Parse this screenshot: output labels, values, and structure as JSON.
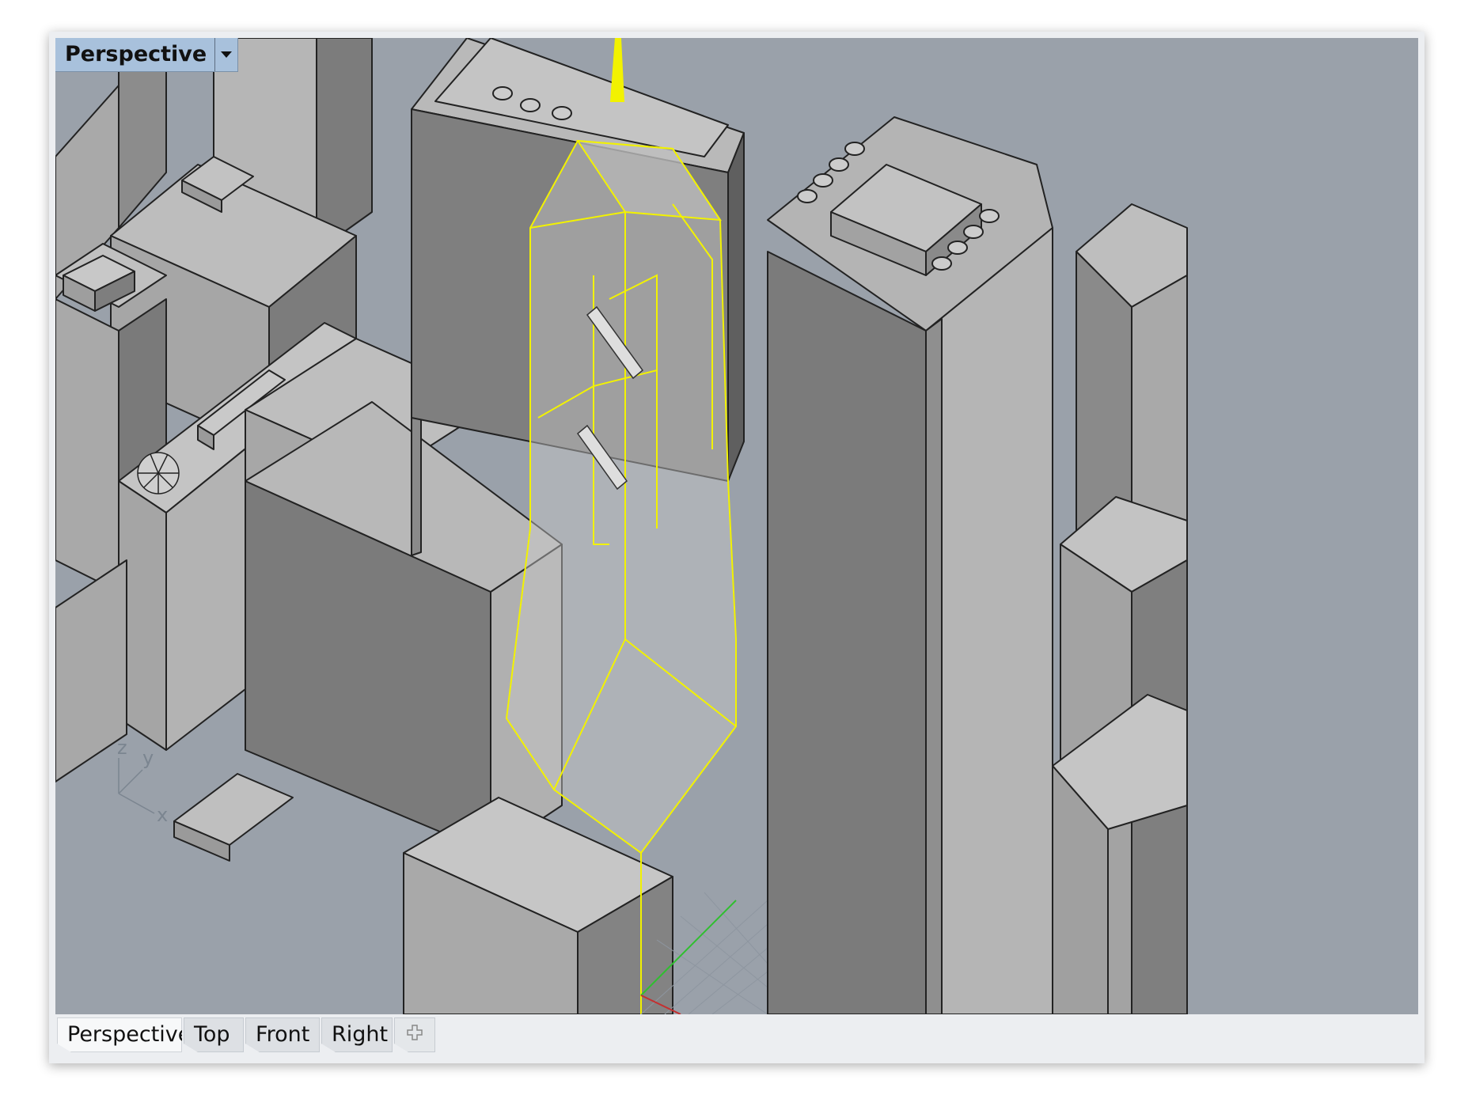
{
  "viewport": {
    "title": "Perspective",
    "menu_icon": "dropdown-triangle-icon"
  },
  "axis_widget": {
    "x": "x",
    "y": "y",
    "z": "z"
  },
  "tabs": [
    {
      "label": "Perspective",
      "active": true
    },
    {
      "label": "Top",
      "active": false
    },
    {
      "label": "Front",
      "active": false
    },
    {
      "label": "Right",
      "active": false
    }
  ],
  "add_tab_icon": "plus-icon",
  "colors": {
    "background": "#9aa1aa",
    "selection": "#f2f200",
    "building_light": "#b4b4b4",
    "building_dark": "#7d7d7d",
    "title_bar": "#a8c1dc"
  }
}
